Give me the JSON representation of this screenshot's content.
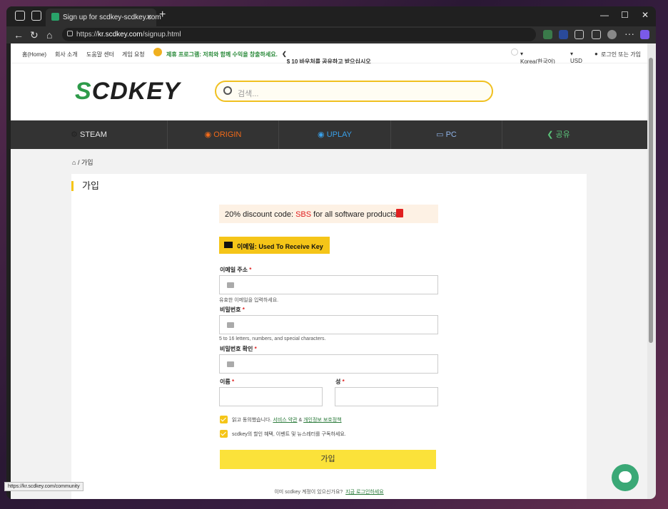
{
  "browser": {
    "tab_title": "Sign up for scdkey-scdkey.com",
    "url_prefix": "https://",
    "url_host": "kr.scdkey.com",
    "url_path": "/signup.html"
  },
  "topbar": {
    "home": "홈(Home)",
    "about": "회사 소개",
    "help": "도움말 센터",
    "game_request": "게임 요청",
    "promo": "제휴 프로그램: 저희와 함께 수익을 창출하세요.",
    "share": "$ 10 바우처를 공유하고 받으십시오",
    "language": "Korea(한국어)",
    "currency": "USD",
    "login": "로그인 또는 가입"
  },
  "logo": {
    "text_s": "S",
    "text_rest": "CDKEY"
  },
  "search": {
    "placeholder": "검색..."
  },
  "menu": [
    {
      "label": "STEAM",
      "color": "#e8e8e8"
    },
    {
      "label": "ORIGIN",
      "color": "#f06a1a"
    },
    {
      "label": "UPLAY",
      "color": "#3aa0e8"
    },
    {
      "label": "PC",
      "color": "#8fb3e8"
    },
    {
      "label": "공유",
      "color": "#5bc47a"
    }
  ],
  "breadcrumb": {
    "current": "가입"
  },
  "form": {
    "title": "가입",
    "discount_pre": "20% discount code: ",
    "discount_code": "SBS",
    "discount_post": " for all software products",
    "email_btn": "이메일: Used To Receive Key",
    "email_label": "이메일 주소",
    "email_hint": "유효한 이메일을 입력하세요.",
    "password_label": "비밀번호",
    "password_hint": "5 to 16 letters, numbers, and special characters.",
    "confirm_label": "비밀번호 확인",
    "first_name_label": "이름",
    "last_name_label": "성",
    "required": "*",
    "agree_pre": "읽고 동의했습니다.",
    "terms": "서비스 약관",
    "amp": "&",
    "privacy": "개인정보 보호정책",
    "newsletter": "scdkey의 할인 혜택, 이벤트 및 뉴스레터를 구독하세요.",
    "submit": "가입",
    "have_account": "이미 scdkey 계정이 있으신가요?",
    "login_now": "지금 로그인하세요"
  },
  "status_url": "https://kr.scdkey.com/community"
}
